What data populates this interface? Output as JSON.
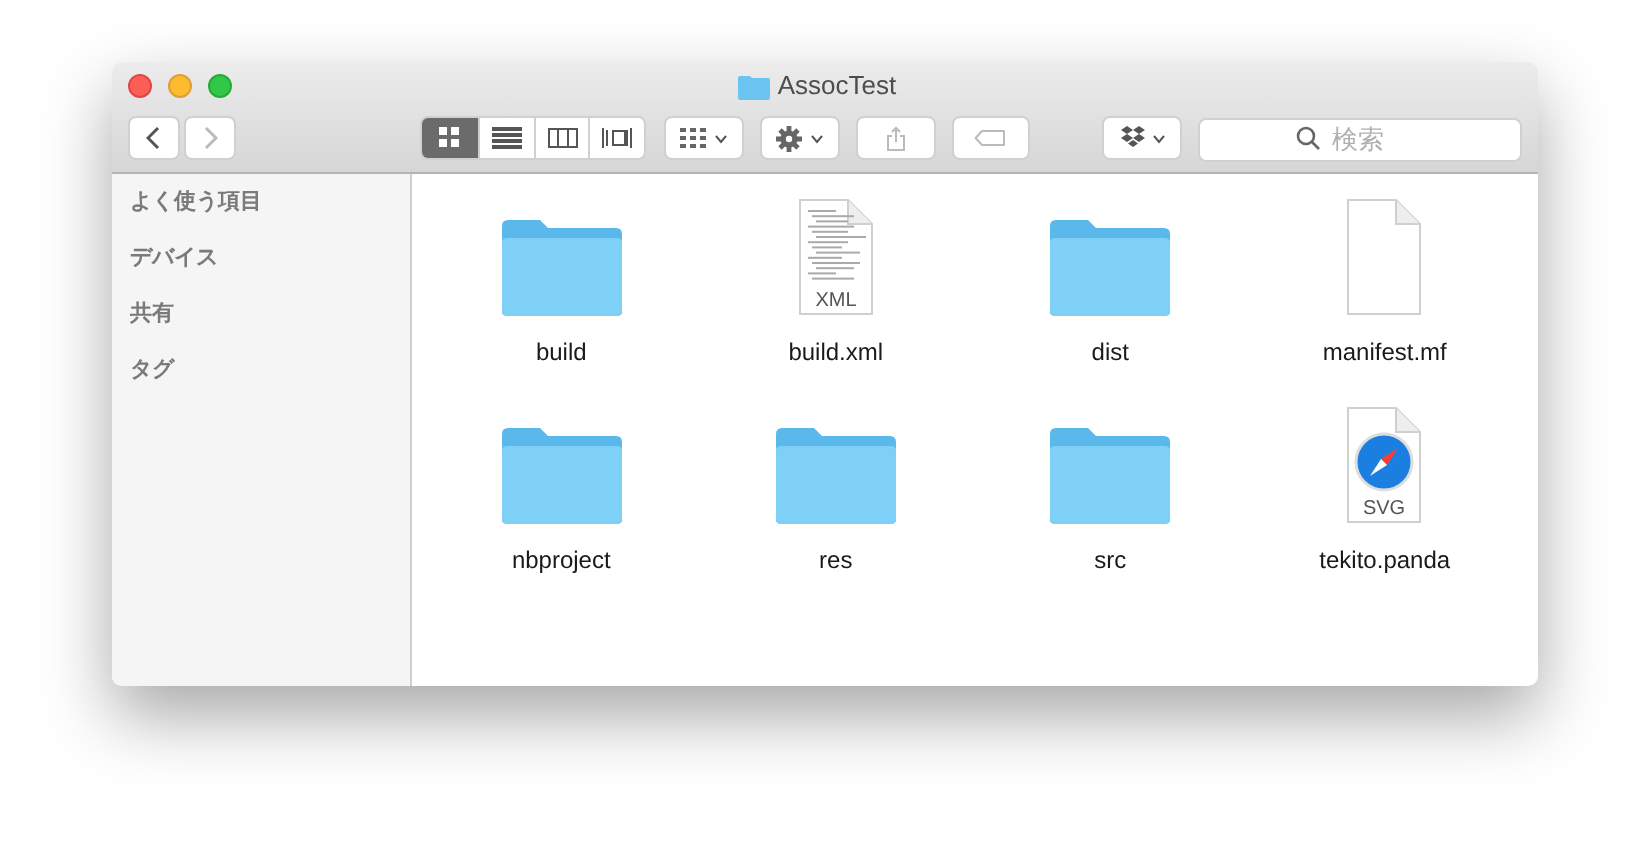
{
  "window": {
    "title": "AssocTest"
  },
  "view_modes": [
    {
      "kind": "icons",
      "selected": true
    },
    {
      "kind": "list",
      "selected": false
    },
    {
      "kind": "columns",
      "selected": false
    },
    {
      "kind": "coverflow",
      "selected": false
    }
  ],
  "search": {
    "placeholder": "検索"
  },
  "sidebar": {
    "items": [
      {
        "label": "よく使う項目"
      },
      {
        "label": "デバイス"
      },
      {
        "label": "共有"
      },
      {
        "label": "タグ"
      }
    ]
  },
  "files": [
    {
      "name": "build",
      "kind": "folder"
    },
    {
      "name": "build.xml",
      "kind": "text-doc",
      "badge": "XML"
    },
    {
      "name": "dist",
      "kind": "folder"
    },
    {
      "name": "manifest.mf",
      "kind": "blank-doc"
    },
    {
      "name": "nbproject",
      "kind": "folder"
    },
    {
      "name": "res",
      "kind": "folder"
    },
    {
      "name": "src",
      "kind": "folder"
    },
    {
      "name": "tekito.panda",
      "kind": "compass-doc",
      "badge": "SVG"
    }
  ]
}
